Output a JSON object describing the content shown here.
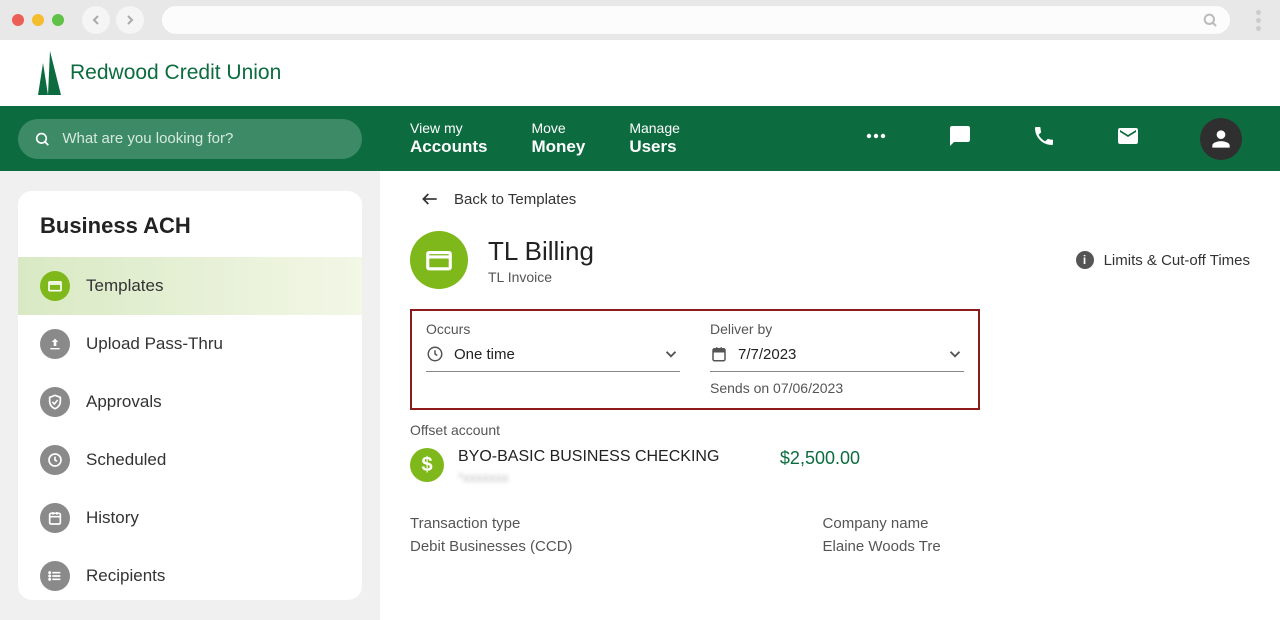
{
  "logo_text": "Redwood Credit Union",
  "search": {
    "placeholder": "What are you looking for?"
  },
  "nav": [
    {
      "top": "View my",
      "bottom": "Accounts"
    },
    {
      "top": "Move",
      "bottom": "Money"
    },
    {
      "top": "Manage",
      "bottom": "Users"
    }
  ],
  "sidebar": {
    "title": "Business ACH",
    "items": [
      {
        "label": "Templates",
        "icon": "folder",
        "active": true
      },
      {
        "label": "Upload Pass-Thru",
        "icon": "upload",
        "active": false
      },
      {
        "label": "Approvals",
        "icon": "shield-check",
        "active": false
      },
      {
        "label": "Scheduled",
        "icon": "clock",
        "active": false
      },
      {
        "label": "History",
        "icon": "calendar",
        "active": false
      },
      {
        "label": "Recipients",
        "icon": "list",
        "active": false
      }
    ]
  },
  "back_label": "Back to Templates",
  "template": {
    "title": "TL Billing",
    "subtitle": "TL Invoice"
  },
  "limits_label": "Limits & Cut-off Times",
  "fields": {
    "occurs": {
      "label": "Occurs",
      "value": "One time"
    },
    "deliver": {
      "label": "Deliver by",
      "value": "7/7/2023",
      "hint": "Sends on 07/06/2023"
    }
  },
  "offset": {
    "label": "Offset account",
    "name": "BYO-BASIC BUSINESS CHECKING",
    "mask": "*xxxxxxx",
    "amount": "$2,500.00"
  },
  "details": {
    "txn_type_label": "Transaction type",
    "txn_type_value": "Debit Businesses (CCD)",
    "company_label": "Company name",
    "company_value": "Elaine Woods Tre"
  }
}
